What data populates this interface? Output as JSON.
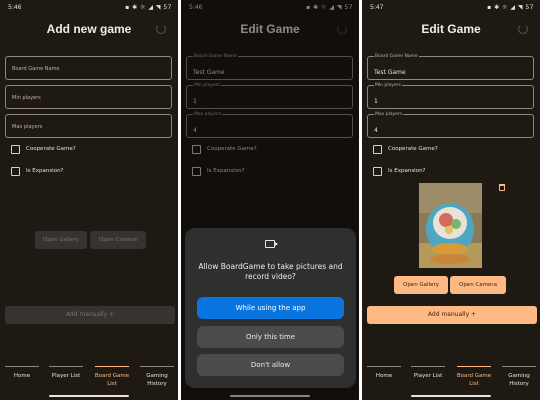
{
  "nav_items": [
    {
      "label_1": "Home",
      "label_2": ""
    },
    {
      "label_1": "Player List",
      "label_2": ""
    },
    {
      "label_1": "Board Game",
      "label_2": "List"
    },
    {
      "label_1": "Gaming",
      "label_2": "History"
    }
  ],
  "phone_add": {
    "status_time": "5:46",
    "status_icons": "▪ ✱ ☼ ◢ ◥ 57",
    "title": "Add new game",
    "fields": [
      {
        "label": "Board Game Name",
        "value": ""
      },
      {
        "label": "Min players",
        "value": ""
      },
      {
        "label": "Max players",
        "value": ""
      }
    ],
    "cooperate_label": "Cooperate Game?",
    "expansion_label": "Is Expansion?",
    "open_gallery": "Open Gallery",
    "open_camera": "Open Camera",
    "add_manually": "Add manually  +",
    "active_nav": 2
  },
  "phone_permission": {
    "status_time": "5:46",
    "status_icons": "▪ ✱ ☼ ◢ ◥ 57",
    "title": "Edit Game",
    "fields": [
      {
        "label": "Board Game Name",
        "value": "Test Game"
      },
      {
        "label": "Min players",
        "value": "1"
      },
      {
        "label": "Max players",
        "value": "4"
      }
    ],
    "cooperate_label": "Cooperate Game?",
    "expansion_label": "Is Expansion?",
    "dialog": {
      "message": "Allow BoardGame to take pictures and record video?",
      "while_using": "While using the app",
      "only_this_time": "Only this time",
      "dont_allow": "Don't allow"
    }
  },
  "phone_edit": {
    "status_time": "5:47",
    "status_icons": "▪ ✱ ☼ ◢ ◥ 57",
    "title": "Edit Game",
    "fields": [
      {
        "label": "Board Game Name",
        "value": "Test Game"
      },
      {
        "label": "Min players",
        "value": "1"
      },
      {
        "label": "Max players",
        "value": "4"
      }
    ],
    "cooperate_label": "Cooperate Game?",
    "expansion_label": "Is Expansion?",
    "open_gallery": "Open Gallery",
    "open_camera": "Open Camera",
    "add_manually": "Add manually  +",
    "active_nav": 2
  },
  "colors": {
    "background": "#1f1914",
    "accent": "#ffb985",
    "accent_text": "#452100",
    "dialog_primary": "#0a75de"
  }
}
